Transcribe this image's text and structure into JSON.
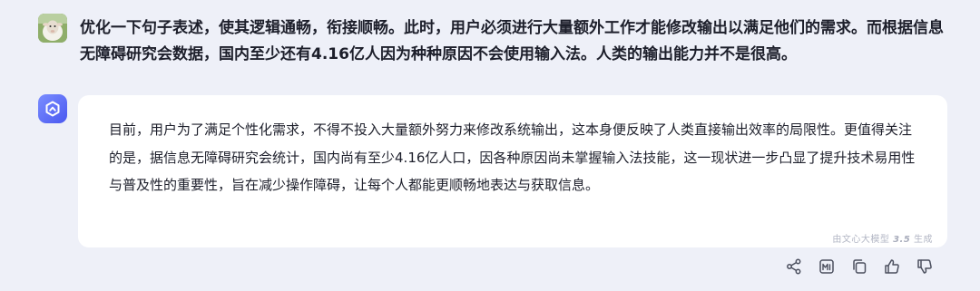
{
  "user_message": {
    "text": "优化一下句子表述，使其逻辑通畅，衔接顺畅。此时，用户必须进行大量额外工作才能修改输出以满足他们的需求。而根据信息无障碍研究会数据，国内至少还有4.16亿人因为种种原因不会使用输入法。人类的输出能力并不是很高。"
  },
  "bot_reply": {
    "text": "目前，用户为了满足个性化需求，不得不投入大量额外努力来修改系统输出，这本身便反映了人类直接输出效率的局限性。更值得关注的是，据信息无障碍研究会统计，国内尚有至少4.16亿人口，因各种原因尚未掌握输入法技能，这一现状进一步凸显了提升技术易用性与普及性的重要性，旨在减少操作障碍，让每个人都能更顺畅地表达与获取信息。",
    "generated_by_prefix": "由文心大模型",
    "generated_by_version": "3.5",
    "generated_by_suffix": "生成"
  },
  "actions": [
    {
      "icon": "share-icon"
    },
    {
      "icon": "chart-icon"
    },
    {
      "icon": "copy-icon"
    },
    {
      "icon": "thumbs-up-icon"
    },
    {
      "icon": "thumbs-down-icon"
    }
  ],
  "colors": {
    "background": "#eef0f8",
    "bubble": "#ffffff",
    "text": "#1d1f2b",
    "accent": "#4a58f0"
  }
}
